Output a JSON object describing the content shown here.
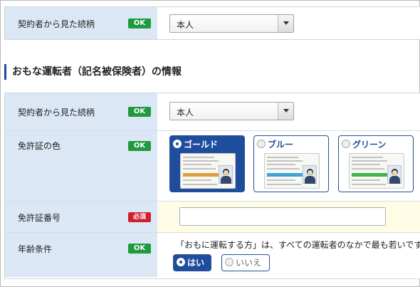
{
  "top_row": {
    "label": "契約者から見た続柄",
    "badge": "OK",
    "select_value": "本人"
  },
  "section_title": "おもな運転者（記名被保険者）の情報",
  "driver": {
    "relationship": {
      "label": "契約者から見た続柄",
      "badge": "OK",
      "select_value": "本人"
    },
    "license_color": {
      "label": "免許証の色",
      "badge": "OK",
      "options": [
        {
          "label": "ゴールド",
          "selected": true,
          "band_color": "#d9a23a"
        },
        {
          "label": "ブルー",
          "selected": false,
          "band_color": "#3fa3d8"
        },
        {
          "label": "グリーン",
          "selected": false,
          "band_color": "#3fb34f"
        }
      ]
    },
    "license_number": {
      "label": "免許証番号",
      "badge": "必須",
      "value": ""
    },
    "age_condition": {
      "label": "年齢条件",
      "badge": "OK",
      "question": "「おもに運転する方」は、すべての運転者のなかで最も若いです",
      "yes_label": "はい",
      "no_label": "いいえ",
      "selected": "yes"
    }
  },
  "colors": {
    "label_bg": "#dbe7f5",
    "accent_blue": "#1f4d9e",
    "ok_green": "#1f9a3e",
    "required_red": "#d0202b",
    "license_number_bg": "#fffce6"
  }
}
